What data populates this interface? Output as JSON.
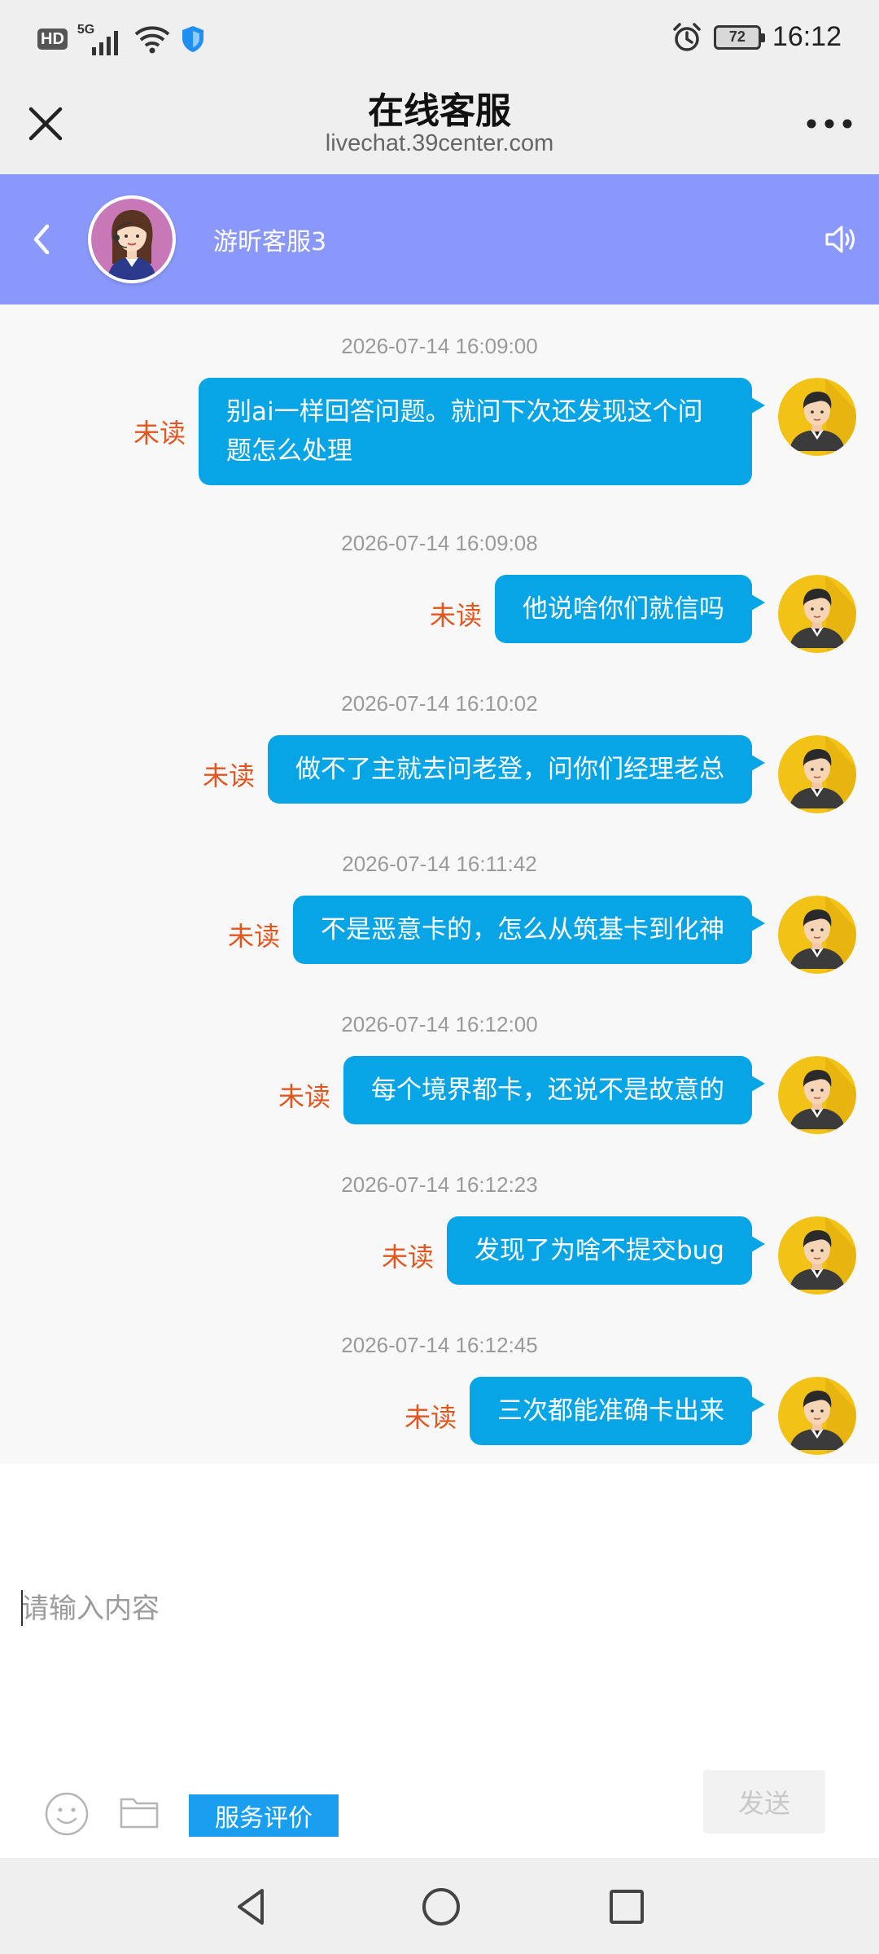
{
  "status_bar": {
    "hd_label": "HD",
    "network_label": "5G",
    "battery_level": "72",
    "time": "16:12"
  },
  "browser": {
    "title": "在线客服",
    "url": "livechat.39center.com"
  },
  "chat_header": {
    "agent_name": "游昕客服3"
  },
  "messages": [
    {
      "timestamp": "2026-07-14 16:09:00",
      "text": "别ai一样回答问题。就问下次还发现这个问题怎么处理",
      "status": "未读"
    },
    {
      "timestamp": "2026-07-14 16:09:08",
      "text": "他说啥你们就信吗",
      "status": "未读"
    },
    {
      "timestamp": "2026-07-14 16:10:02",
      "text": "做不了主就去问老登，问你们经理老总",
      "status": "未读"
    },
    {
      "timestamp": "2026-07-14 16:11:42",
      "text": "不是恶意卡的，怎么从筑基卡到化神",
      "status": "未读"
    },
    {
      "timestamp": "2026-07-14 16:12:00",
      "text": "每个境界都卡，还说不是故意的",
      "status": "未读"
    },
    {
      "timestamp": "2026-07-14 16:12:23",
      "text": "发现了为啥不提交bug",
      "status": "未读"
    },
    {
      "timestamp": "2026-07-14 16:12:45",
      "text": "三次都能准确卡出来",
      "status": "未读"
    }
  ],
  "composer": {
    "placeholder": "请输入内容",
    "rating_label": "服务评价",
    "send_label": "发送"
  },
  "colors": {
    "chat_header_bg": "#8b98fb",
    "bubble_bg": "#07a5e6",
    "unread_text": "#e2561f",
    "rating_button_bg": "#1a9ff0"
  },
  "icons": {
    "close": "close-icon",
    "more": "more-dots-icon",
    "back": "chevron-left-icon",
    "speaker": "speaker-icon",
    "emoji": "emoji-icon",
    "folder": "folder-icon"
  }
}
